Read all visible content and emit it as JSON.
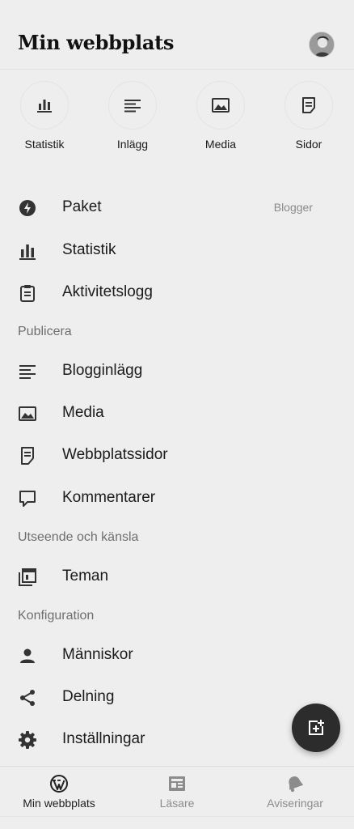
{
  "header": {
    "site_title": "Min webbplats"
  },
  "quick_actions": [
    {
      "label": "Statistik",
      "icon": "bar-chart-icon"
    },
    {
      "label": "Inlägg",
      "icon": "posts-icon"
    },
    {
      "label": "Media",
      "icon": "image-icon"
    },
    {
      "label": "Sidor",
      "icon": "page-icon"
    }
  ],
  "menu": {
    "paket": {
      "label": "Paket",
      "meta": "Blogger",
      "icon": "plan-icon"
    },
    "statistik": {
      "label": "Statistik",
      "icon": "bar-chart-icon"
    },
    "aktivitetslogg": {
      "label": "Aktivitetslogg",
      "icon": "clipboard-icon"
    },
    "section_publicera": "Publicera",
    "blogginlagg": {
      "label": "Blogginlägg",
      "icon": "posts-icon"
    },
    "media": {
      "label": "Media",
      "icon": "image-icon"
    },
    "webbplatssidor": {
      "label": "Webbplatssidor",
      "icon": "page-icon"
    },
    "kommentarer": {
      "label": "Kommentarer",
      "icon": "comment-icon"
    },
    "section_utseende": "Utseende och känsla",
    "teman": {
      "label": "Teman",
      "icon": "themes-icon"
    },
    "section_konfiguration": "Konfiguration",
    "manniskor": {
      "label": "Människor",
      "icon": "person-icon"
    },
    "delning": {
      "label": "Delning",
      "icon": "share-icon"
    },
    "installningar": {
      "label": "Inställningar",
      "icon": "gear-icon"
    }
  },
  "bottom_nav": [
    {
      "label": "Min webbplats",
      "icon": "wordpress-icon",
      "active": true
    },
    {
      "label": "Läsare",
      "icon": "reader-icon",
      "active": false
    },
    {
      "label": "Aviseringar",
      "icon": "bell-icon",
      "active": false
    }
  ],
  "colors": {
    "background": "#eeeeee",
    "text": "#1e1e1e",
    "muted": "#8a8a8a",
    "fab": "#2c2c2c"
  }
}
